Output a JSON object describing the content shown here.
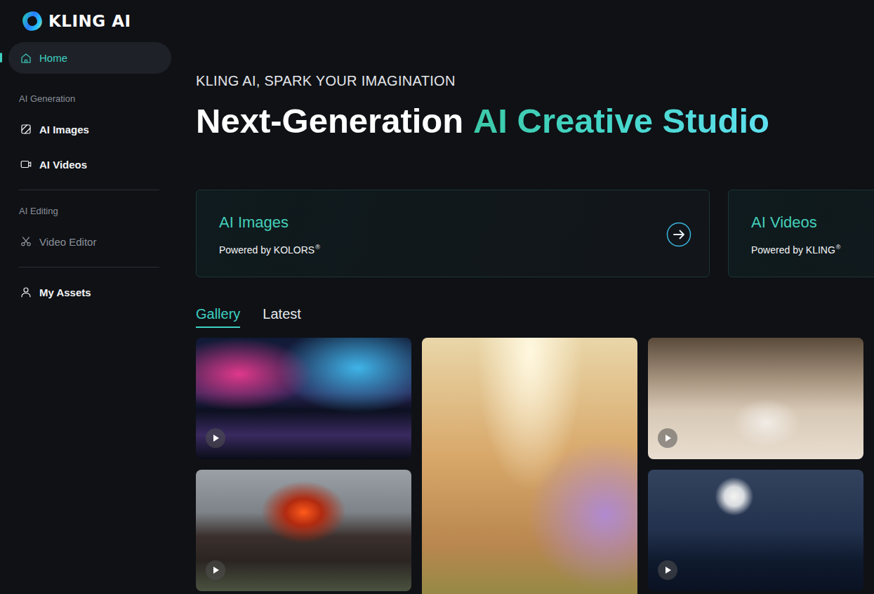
{
  "brand": {
    "name": "KLING AI"
  },
  "sidebar": {
    "groups": [
      {
        "items": [
          {
            "label": "Home",
            "selected": true,
            "disabled": false
          }
        ]
      },
      {
        "heading": "AI Generation",
        "items": [
          {
            "label": "AI Images",
            "selected": false,
            "disabled": false
          },
          {
            "label": "AI Videos",
            "selected": false,
            "disabled": false
          }
        ]
      },
      {
        "heading": "AI Editing",
        "items": [
          {
            "label": "Video Editor",
            "selected": false,
            "disabled": true
          }
        ]
      },
      {
        "items": [
          {
            "label": "My Assets",
            "selected": false,
            "disabled": false
          }
        ]
      }
    ]
  },
  "hero": {
    "eyebrow": "KLING AI, SPARK YOUR IMAGINATION",
    "title": "Next-Generation",
    "title_accent": "AI Creative Studio"
  },
  "cards": [
    {
      "title": "AI Images",
      "subtitle": "Powered by KOLORS",
      "trademark": "®"
    },
    {
      "title": "AI Videos",
      "subtitle": "Powered by KLING",
      "trademark": "®"
    }
  ],
  "tabs": [
    {
      "label": "Gallery",
      "selected": true
    },
    {
      "label": "Latest",
      "selected": false
    }
  ],
  "gallery": {
    "columns": [
      [
        {
          "kind": "video"
        },
        {
          "kind": "video"
        }
      ],
      [
        {
          "kind": "image"
        }
      ],
      [
        {
          "kind": "video"
        },
        {
          "kind": "video"
        }
      ]
    ]
  }
}
